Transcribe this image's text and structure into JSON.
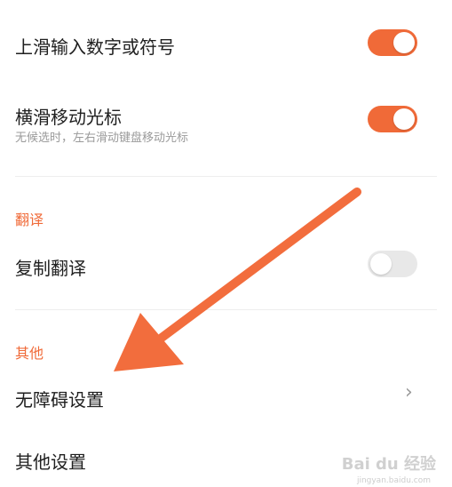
{
  "colors": {
    "accent": "#f06a38",
    "toggle_off": "#e8e8e8",
    "arrow": "#f26d3d"
  },
  "settings": {
    "slide_up": {
      "title": "上滑输入数字或符号",
      "enabled": true
    },
    "swipe_cursor": {
      "title": "横滑移动光标",
      "subtitle": "无候选时，左右滑动键盘移动光标",
      "enabled": true
    },
    "translate_section": {
      "header": "翻译"
    },
    "copy_translate": {
      "title": "复制翻译",
      "enabled": false
    },
    "other_section": {
      "header": "其他"
    },
    "accessibility": {
      "title": "无障碍设置",
      "chevron": "›"
    },
    "other_settings": {
      "title": "其他设置"
    }
  },
  "watermark": {
    "text": "Bai du 经验",
    "sub": "jingyan.baidu.com"
  }
}
